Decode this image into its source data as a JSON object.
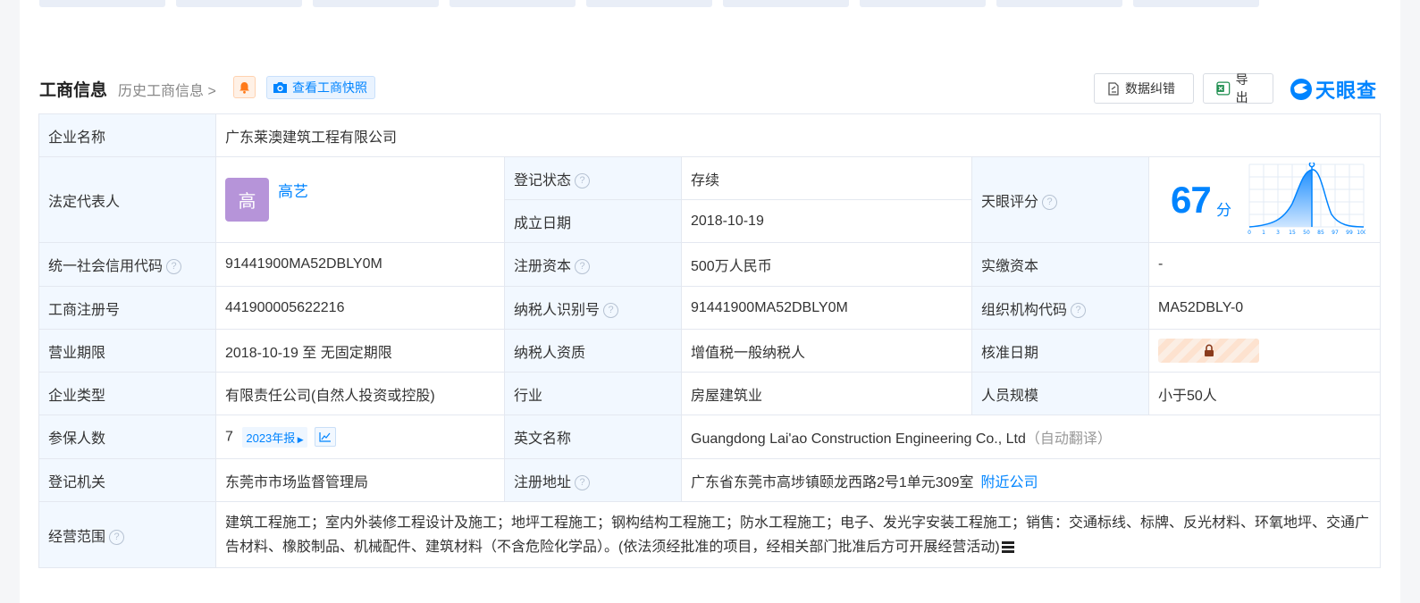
{
  "header": {
    "title": "工商信息",
    "history_link": "历史工商信息",
    "snapshot_button": "查看工商快照",
    "correct_button": "数据纠错",
    "export_button": "导出",
    "logo_text": "天眼查"
  },
  "colors": {
    "accent": "#0084ff",
    "status_green": "#1db954",
    "label_bg": "#f2f8ff",
    "avatar": "#b694d9"
  },
  "table": {
    "company_name_label": "企业名称",
    "company_name": "广东莱澳建筑工程有限公司",
    "legal_rep_label": "法定代表人",
    "legal_rep_avatar": "高",
    "legal_rep_name": "高艺",
    "status_label": "登记状态",
    "status": "存续",
    "founded_label": "成立日期",
    "founded": "2018-10-19",
    "score_label": "天眼评分",
    "score": "67",
    "score_unit": "分",
    "score_axis_ticks": [
      "0",
      "1",
      "3",
      "15",
      "50",
      "85",
      "97",
      "99",
      "100"
    ],
    "credit_code_label": "统一社会信用代码",
    "credit_code": "91441900MA52DBLY0M",
    "reg_capital_label": "注册资本",
    "reg_capital": "500万人民币",
    "paid_capital_label": "实缴资本",
    "paid_capital": "-",
    "reg_no_label": "工商注册号",
    "reg_no": "441900005622216",
    "taxpayer_id_label": "纳税人识别号",
    "taxpayer_id": "91441900MA52DBLY0M",
    "org_code_label": "组织机构代码",
    "org_code": "MA52DBLY-0",
    "term_label": "营业期限",
    "term": "2018-10-19 至 无固定期限",
    "tax_qual_label": "纳税人资质",
    "tax_qual": "增值税一般纳税人",
    "approval_date_label": "核准日期",
    "company_type_label": "企业类型",
    "company_type": "有限责任公司(自然人投资或控股)",
    "industry_label": "行业",
    "industry": "房屋建筑业",
    "staff_size_label": "人员规模",
    "staff_size": "小于50人",
    "insured_label": "参保人数",
    "insured": "7",
    "insured_report": "2023年报",
    "english_name_label": "英文名称",
    "english_name": "Guangdong Lai'ao Construction Engineering Co., Ltd",
    "english_name_note": "（自动翻译）",
    "authority_label": "登记机关",
    "authority": "东莞市市场监督管理局",
    "address_label": "注册地址",
    "address": "广东省东莞市高埗镇颐龙西路2号1单元309室",
    "nearby_link": "附近公司",
    "scope_label": "经营范围",
    "scope": "建筑工程施工；室内外装修工程设计及施工；地坪工程施工；钢构结构工程施工；防水工程施工；电子、发光字安装工程施工；销售：交通标线、标牌、反光材料、环氧地坪、交通广告材料、橡胶制品、机械配件、建筑材料（不含危险化学品）。(依法须经批准的项目，经相关部门批准后方可开展经营活动)"
  }
}
